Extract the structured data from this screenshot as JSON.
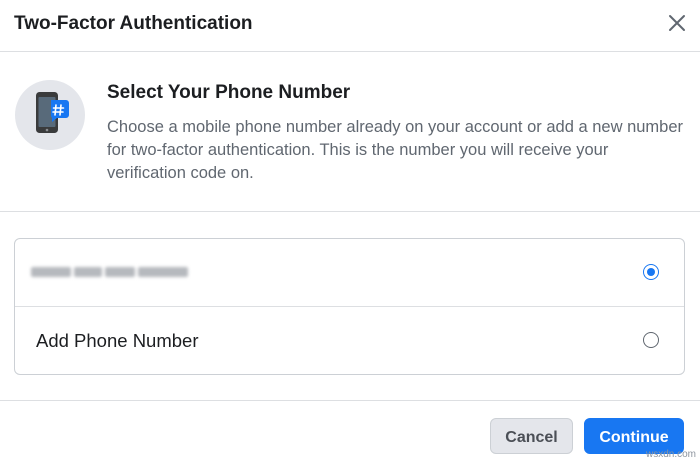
{
  "dialog": {
    "title": "Two-Factor Authentication",
    "close_icon": "close-icon"
  },
  "intro": {
    "icon": "phone-hashtag-icon",
    "heading": "Select Your Phone Number",
    "description": "Choose a mobile phone number already on your account or add a new number for two-factor authentication. This is the number you will receive your verification code on."
  },
  "options": [
    {
      "label": "",
      "obscured": true,
      "selected": true
    },
    {
      "label": "Add Phone Number",
      "selected": false
    }
  ],
  "buttons": {
    "cancel": "Cancel",
    "continue": "Continue"
  },
  "colors": {
    "primary": "#1877f2",
    "text": "#1c1e21",
    "secondary_text": "#606770"
  },
  "watermark": "wsxdn.com"
}
